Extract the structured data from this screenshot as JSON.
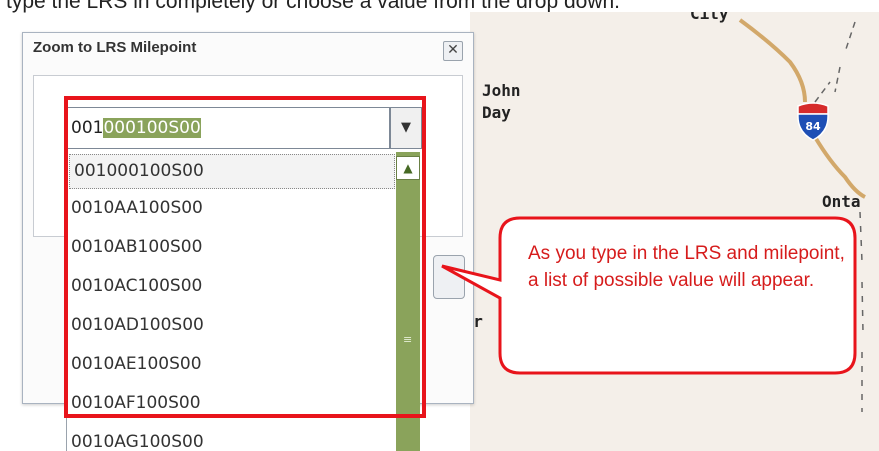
{
  "instruction": "type the LRS in completely or choose a value from the drop down.",
  "map": {
    "labels": {
      "city": "City",
      "john_day": "John\nDay",
      "ontario": "Onta",
      "burns": "Bur"
    },
    "shield": {
      "route": "84",
      "color": "#1e4fb5",
      "band": "#d62b2b"
    }
  },
  "dialog": {
    "title": "Zoom to LRS Milepoint",
    "close_glyph": "✕",
    "combo": {
      "typed_prefix": "001",
      "selected_suffix": "000100S00",
      "dropdown_glyph": "▼"
    },
    "list": {
      "items": [
        "001000100S00",
        "0010AA100S00",
        "0010AB100S00",
        "0010AC100S00",
        "0010AD100S00",
        "0010AE100S00",
        "0010AF100S00",
        "0010AG100S00"
      ]
    },
    "scroll_up_glyph": "▲",
    "scroll_grip_glyph": "≡"
  },
  "callout": {
    "text": "As you type in the LRS and milepoint, a list of possible value will appear.",
    "color": "#e8141b"
  }
}
